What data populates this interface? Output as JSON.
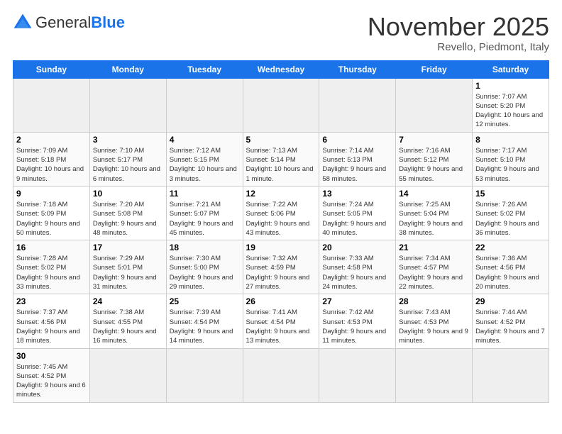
{
  "header": {
    "logo_general": "General",
    "logo_blue": "Blue",
    "month_title": "November 2025",
    "location": "Revello, Piedmont, Italy"
  },
  "weekdays": [
    "Sunday",
    "Monday",
    "Tuesday",
    "Wednesday",
    "Thursday",
    "Friday",
    "Saturday"
  ],
  "weeks": [
    [
      {
        "day": "",
        "empty": true
      },
      {
        "day": "",
        "empty": true
      },
      {
        "day": "",
        "empty": true
      },
      {
        "day": "",
        "empty": true
      },
      {
        "day": "",
        "empty": true
      },
      {
        "day": "",
        "empty": true
      },
      {
        "day": "1",
        "sunrise": "7:07 AM",
        "sunset": "5:20 PM",
        "daylight": "10 hours and 12 minutes."
      }
    ],
    [
      {
        "day": "2",
        "sunrise": "7:09 AM",
        "sunset": "5:18 PM",
        "daylight": "10 hours and 9 minutes."
      },
      {
        "day": "3",
        "sunrise": "7:10 AM",
        "sunset": "5:17 PM",
        "daylight": "10 hours and 6 minutes."
      },
      {
        "day": "4",
        "sunrise": "7:12 AM",
        "sunset": "5:15 PM",
        "daylight": "10 hours and 3 minutes."
      },
      {
        "day": "5",
        "sunrise": "7:13 AM",
        "sunset": "5:14 PM",
        "daylight": "10 hours and 1 minute."
      },
      {
        "day": "6",
        "sunrise": "7:14 AM",
        "sunset": "5:13 PM",
        "daylight": "9 hours and 58 minutes."
      },
      {
        "day": "7",
        "sunrise": "7:16 AM",
        "sunset": "5:12 PM",
        "daylight": "9 hours and 55 minutes."
      },
      {
        "day": "8",
        "sunrise": "7:17 AM",
        "sunset": "5:10 PM",
        "daylight": "9 hours and 53 minutes."
      }
    ],
    [
      {
        "day": "9",
        "sunrise": "7:18 AM",
        "sunset": "5:09 PM",
        "daylight": "9 hours and 50 minutes."
      },
      {
        "day": "10",
        "sunrise": "7:20 AM",
        "sunset": "5:08 PM",
        "daylight": "9 hours and 48 minutes."
      },
      {
        "day": "11",
        "sunrise": "7:21 AM",
        "sunset": "5:07 PM",
        "daylight": "9 hours and 45 minutes."
      },
      {
        "day": "12",
        "sunrise": "7:22 AM",
        "sunset": "5:06 PM",
        "daylight": "9 hours and 43 minutes."
      },
      {
        "day": "13",
        "sunrise": "7:24 AM",
        "sunset": "5:05 PM",
        "daylight": "9 hours and 40 minutes."
      },
      {
        "day": "14",
        "sunrise": "7:25 AM",
        "sunset": "5:04 PM",
        "daylight": "9 hours and 38 minutes."
      },
      {
        "day": "15",
        "sunrise": "7:26 AM",
        "sunset": "5:02 PM",
        "daylight": "9 hours and 36 minutes."
      }
    ],
    [
      {
        "day": "16",
        "sunrise": "7:28 AM",
        "sunset": "5:02 PM",
        "daylight": "9 hours and 33 minutes."
      },
      {
        "day": "17",
        "sunrise": "7:29 AM",
        "sunset": "5:01 PM",
        "daylight": "9 hours and 31 minutes."
      },
      {
        "day": "18",
        "sunrise": "7:30 AM",
        "sunset": "5:00 PM",
        "daylight": "9 hours and 29 minutes."
      },
      {
        "day": "19",
        "sunrise": "7:32 AM",
        "sunset": "4:59 PM",
        "daylight": "9 hours and 27 minutes."
      },
      {
        "day": "20",
        "sunrise": "7:33 AM",
        "sunset": "4:58 PM",
        "daylight": "9 hours and 24 minutes."
      },
      {
        "day": "21",
        "sunrise": "7:34 AM",
        "sunset": "4:57 PM",
        "daylight": "9 hours and 22 minutes."
      },
      {
        "day": "22",
        "sunrise": "7:36 AM",
        "sunset": "4:56 PM",
        "daylight": "9 hours and 20 minutes."
      }
    ],
    [
      {
        "day": "23",
        "sunrise": "7:37 AM",
        "sunset": "4:56 PM",
        "daylight": "9 hours and 18 minutes."
      },
      {
        "day": "24",
        "sunrise": "7:38 AM",
        "sunset": "4:55 PM",
        "daylight": "9 hours and 16 minutes."
      },
      {
        "day": "25",
        "sunrise": "7:39 AM",
        "sunset": "4:54 PM",
        "daylight": "9 hours and 14 minutes."
      },
      {
        "day": "26",
        "sunrise": "7:41 AM",
        "sunset": "4:54 PM",
        "daylight": "9 hours and 13 minutes."
      },
      {
        "day": "27",
        "sunrise": "7:42 AM",
        "sunset": "4:53 PM",
        "daylight": "9 hours and 11 minutes."
      },
      {
        "day": "28",
        "sunrise": "7:43 AM",
        "sunset": "4:53 PM",
        "daylight": "9 hours and 9 minutes."
      },
      {
        "day": "29",
        "sunrise": "7:44 AM",
        "sunset": "4:52 PM",
        "daylight": "9 hours and 7 minutes."
      }
    ],
    [
      {
        "day": "30",
        "sunrise": "7:45 AM",
        "sunset": "4:52 PM",
        "daylight": "9 hours and 6 minutes."
      },
      {
        "day": "",
        "empty": true
      },
      {
        "day": "",
        "empty": true
      },
      {
        "day": "",
        "empty": true
      },
      {
        "day": "",
        "empty": true
      },
      {
        "day": "",
        "empty": true
      },
      {
        "day": "",
        "empty": true
      }
    ]
  ]
}
